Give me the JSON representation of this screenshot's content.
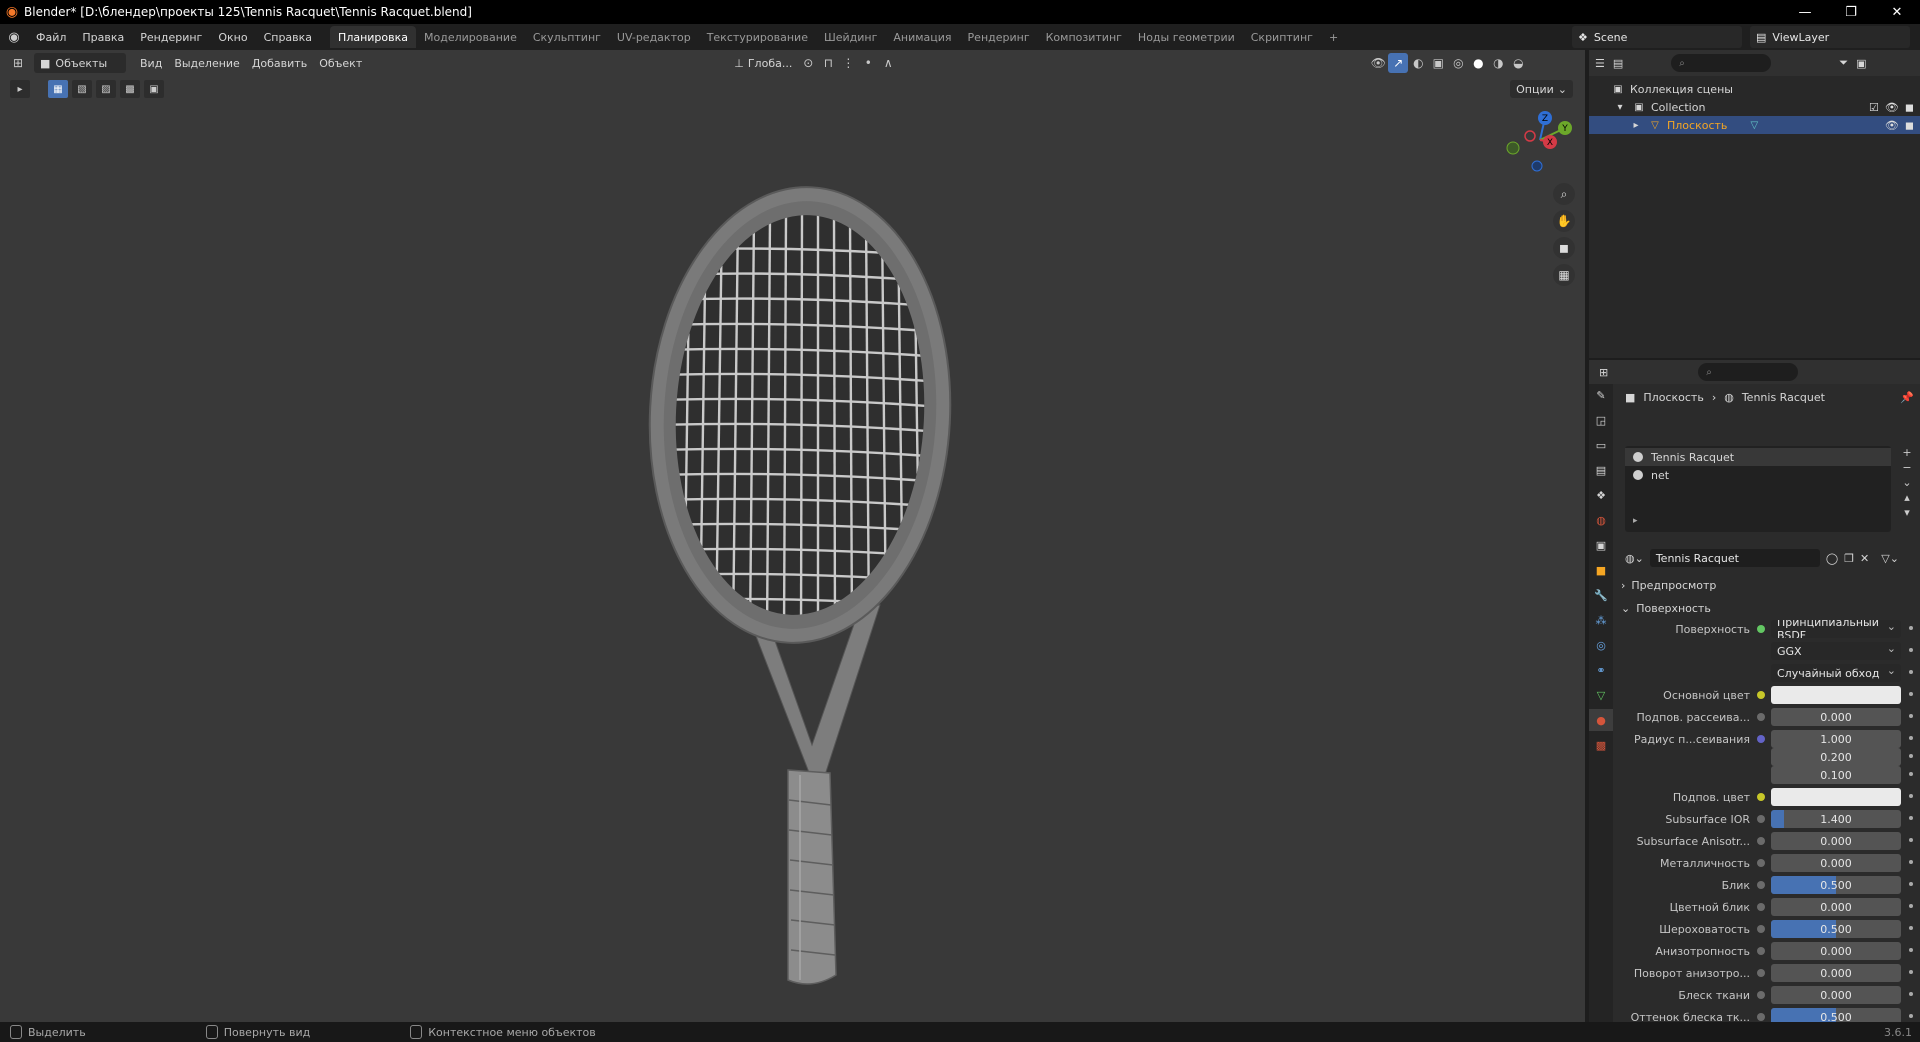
{
  "titlebar": {
    "title": "Blender* [D:\\блендер\\проекты 125\\Tennis Racquet\\Tennis Racquet.blend]",
    "minimize": "—",
    "maximize": "❐",
    "close": "✕"
  },
  "menu": [
    "Файл",
    "Правка",
    "Рендеринг",
    "Окно",
    "Справка"
  ],
  "workspaces": [
    "Планировка",
    "Моделирование",
    "Скульптинг",
    "UV-редактор",
    "Текстурирование",
    "Шейдинг",
    "Анимация",
    "Рендеринг",
    "Композитинг",
    "Ноды геометрии",
    "Скриптинг",
    "+"
  ],
  "active_workspace": "Планировка",
  "scene": "Scene",
  "view_layer": "ViewLayer",
  "viewport": {
    "mode": "Объекты",
    "menus": [
      "Вид",
      "Выделение",
      "Добавить",
      "Объект"
    ],
    "transform_orientation": "Глоба...",
    "options": "Опции",
    "gizmo_labels": {
      "z": "Z",
      "y": "Y",
      "x": "X"
    }
  },
  "outliner": {
    "scene_collection": "Коллекция сцены",
    "collection": "Collection",
    "object": "Плоскость"
  },
  "properties": {
    "breadcrumb_object": "Плоскость",
    "breadcrumb_material": "Tennis Racquet",
    "slots": [
      "Tennis Racquet",
      "net"
    ],
    "material_name": "Tennis Racquet",
    "panel_preview": "Предпросмотр",
    "panel_surface": "Поверхность",
    "rows": [
      {
        "label": "Поверхность",
        "value": "Принципиальный BSDF",
        "kind": "node",
        "dot": "green"
      },
      {
        "label": "",
        "value": "GGX",
        "kind": "dropdown",
        "dot": ""
      },
      {
        "label": "",
        "value": "Случайный обход",
        "kind": "dropdown",
        "dot": ""
      },
      {
        "label": "Основной цвет",
        "value": "",
        "kind": "color",
        "dot": "yellow"
      },
      {
        "label": "Подпов. рассеива...",
        "value": "0.000",
        "kind": "num",
        "fill": 0,
        "dot": "grey"
      },
      {
        "label": "Радиус п...сеивания",
        "value": "1.000",
        "kind": "num",
        "fill": 0,
        "dot": "purple"
      },
      {
        "label": "",
        "value": "0.200",
        "kind": "num",
        "fill": 0,
        "dot": ""
      },
      {
        "label": "",
        "value": "0.100",
        "kind": "num",
        "fill": 0,
        "dot": ""
      },
      {
        "label": "Подпов. цвет",
        "value": "",
        "kind": "color",
        "dot": "yellow"
      },
      {
        "label": "Subsurface IOR",
        "value": "1.400",
        "kind": "num",
        "fill": 0.1,
        "dot": "grey"
      },
      {
        "label": "Subsurface Anisotr...",
        "value": "0.000",
        "kind": "num",
        "fill": 0,
        "dot": "grey"
      },
      {
        "label": "Металличность",
        "value": "0.000",
        "kind": "num",
        "fill": 0,
        "dot": "grey"
      },
      {
        "label": "Блик",
        "value": "0.500",
        "kind": "num",
        "fill": 0.5,
        "dot": "grey"
      },
      {
        "label": "Цветной блик",
        "value": "0.000",
        "kind": "num",
        "fill": 0,
        "dot": "grey"
      },
      {
        "label": "Шероховатость",
        "value": "0.500",
        "kind": "num",
        "fill": 0.5,
        "dot": "grey"
      },
      {
        "label": "Анизотропность",
        "value": "0.000",
        "kind": "num",
        "fill": 0,
        "dot": "grey"
      },
      {
        "label": "Поворот анизотро...",
        "value": "0.000",
        "kind": "num",
        "fill": 0,
        "dot": "grey"
      },
      {
        "label": "Блеск ткани",
        "value": "0.000",
        "kind": "num",
        "fill": 0,
        "dot": "grey"
      },
      {
        "label": "Оттенок блеска тк...",
        "value": "0.500",
        "kind": "num",
        "fill": 0.5,
        "dot": "grey"
      }
    ]
  },
  "statusbar": {
    "select": "Выделить",
    "rotate": "Повернуть вид",
    "context": "Контекстное меню объектов",
    "version": "3.6.1"
  },
  "colors": {
    "accent": "#4772b3",
    "selection": "#334d80",
    "viewport_bg": "#393939",
    "object_highlight": "#f5a623"
  }
}
